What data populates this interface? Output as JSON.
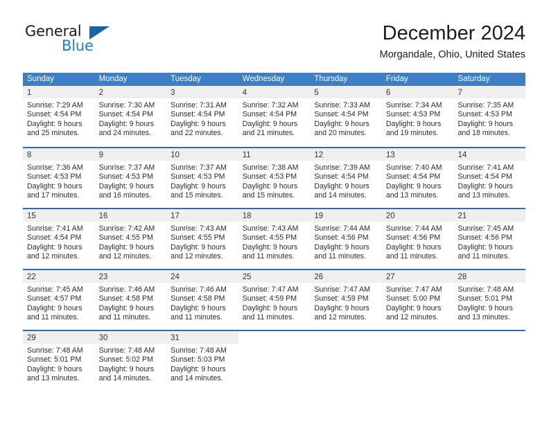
{
  "brand": {
    "name_top": "General",
    "name_bottom": "Blue",
    "accent_color": "#1f7ac4",
    "triangle_color": "#1565a8"
  },
  "header": {
    "month_title": "December 2024",
    "location": "Morgandale, Ohio, United States"
  },
  "calendar": {
    "header_color": "#3b7fc4",
    "separator_color": "#2a6db5",
    "daynum_band_color": "#efefef",
    "weekdays": [
      "Sunday",
      "Monday",
      "Tuesday",
      "Wednesday",
      "Thursday",
      "Friday",
      "Saturday"
    ],
    "weeks": [
      [
        {
          "day": "1",
          "lines": [
            "Sunrise: 7:29 AM",
            "Sunset: 4:54 PM",
            "Daylight: 9 hours",
            "and 25 minutes."
          ]
        },
        {
          "day": "2",
          "lines": [
            "Sunrise: 7:30 AM",
            "Sunset: 4:54 PM",
            "Daylight: 9 hours",
            "and 24 minutes."
          ]
        },
        {
          "day": "3",
          "lines": [
            "Sunrise: 7:31 AM",
            "Sunset: 4:54 PM",
            "Daylight: 9 hours",
            "and 22 minutes."
          ]
        },
        {
          "day": "4",
          "lines": [
            "Sunrise: 7:32 AM",
            "Sunset: 4:54 PM",
            "Daylight: 9 hours",
            "and 21 minutes."
          ]
        },
        {
          "day": "5",
          "lines": [
            "Sunrise: 7:33 AM",
            "Sunset: 4:54 PM",
            "Daylight: 9 hours",
            "and 20 minutes."
          ]
        },
        {
          "day": "6",
          "lines": [
            "Sunrise: 7:34 AM",
            "Sunset: 4:53 PM",
            "Daylight: 9 hours",
            "and 19 minutes."
          ]
        },
        {
          "day": "7",
          "lines": [
            "Sunrise: 7:35 AM",
            "Sunset: 4:53 PM",
            "Daylight: 9 hours",
            "and 18 minutes."
          ]
        }
      ],
      [
        {
          "day": "8",
          "lines": [
            "Sunrise: 7:36 AM",
            "Sunset: 4:53 PM",
            "Daylight: 9 hours",
            "and 17 minutes."
          ]
        },
        {
          "day": "9",
          "lines": [
            "Sunrise: 7:37 AM",
            "Sunset: 4:53 PM",
            "Daylight: 9 hours",
            "and 16 minutes."
          ]
        },
        {
          "day": "10",
          "lines": [
            "Sunrise: 7:37 AM",
            "Sunset: 4:53 PM",
            "Daylight: 9 hours",
            "and 15 minutes."
          ]
        },
        {
          "day": "11",
          "lines": [
            "Sunrise: 7:38 AM",
            "Sunset: 4:53 PM",
            "Daylight: 9 hours",
            "and 15 minutes."
          ]
        },
        {
          "day": "12",
          "lines": [
            "Sunrise: 7:39 AM",
            "Sunset: 4:54 PM",
            "Daylight: 9 hours",
            "and 14 minutes."
          ]
        },
        {
          "day": "13",
          "lines": [
            "Sunrise: 7:40 AM",
            "Sunset: 4:54 PM",
            "Daylight: 9 hours",
            "and 13 minutes."
          ]
        },
        {
          "day": "14",
          "lines": [
            "Sunrise: 7:41 AM",
            "Sunset: 4:54 PM",
            "Daylight: 9 hours",
            "and 13 minutes."
          ]
        }
      ],
      [
        {
          "day": "15",
          "lines": [
            "Sunrise: 7:41 AM",
            "Sunset: 4:54 PM",
            "Daylight: 9 hours",
            "and 12 minutes."
          ]
        },
        {
          "day": "16",
          "lines": [
            "Sunrise: 7:42 AM",
            "Sunset: 4:55 PM",
            "Daylight: 9 hours",
            "and 12 minutes."
          ]
        },
        {
          "day": "17",
          "lines": [
            "Sunrise: 7:43 AM",
            "Sunset: 4:55 PM",
            "Daylight: 9 hours",
            "and 12 minutes."
          ]
        },
        {
          "day": "18",
          "lines": [
            "Sunrise: 7:43 AM",
            "Sunset: 4:55 PM",
            "Daylight: 9 hours",
            "and 11 minutes."
          ]
        },
        {
          "day": "19",
          "lines": [
            "Sunrise: 7:44 AM",
            "Sunset: 4:56 PM",
            "Daylight: 9 hours",
            "and 11 minutes."
          ]
        },
        {
          "day": "20",
          "lines": [
            "Sunrise: 7:44 AM",
            "Sunset: 4:56 PM",
            "Daylight: 9 hours",
            "and 11 minutes."
          ]
        },
        {
          "day": "21",
          "lines": [
            "Sunrise: 7:45 AM",
            "Sunset: 4:56 PM",
            "Daylight: 9 hours",
            "and 11 minutes."
          ]
        }
      ],
      [
        {
          "day": "22",
          "lines": [
            "Sunrise: 7:45 AM",
            "Sunset: 4:57 PM",
            "Daylight: 9 hours",
            "and 11 minutes."
          ]
        },
        {
          "day": "23",
          "lines": [
            "Sunrise: 7:46 AM",
            "Sunset: 4:58 PM",
            "Daylight: 9 hours",
            "and 11 minutes."
          ]
        },
        {
          "day": "24",
          "lines": [
            "Sunrise: 7:46 AM",
            "Sunset: 4:58 PM",
            "Daylight: 9 hours",
            "and 11 minutes."
          ]
        },
        {
          "day": "25",
          "lines": [
            "Sunrise: 7:47 AM",
            "Sunset: 4:59 PM",
            "Daylight: 9 hours",
            "and 11 minutes."
          ]
        },
        {
          "day": "26",
          "lines": [
            "Sunrise: 7:47 AM",
            "Sunset: 4:59 PM",
            "Daylight: 9 hours",
            "and 12 minutes."
          ]
        },
        {
          "day": "27",
          "lines": [
            "Sunrise: 7:47 AM",
            "Sunset: 5:00 PM",
            "Daylight: 9 hours",
            "and 12 minutes."
          ]
        },
        {
          "day": "28",
          "lines": [
            "Sunrise: 7:48 AM",
            "Sunset: 5:01 PM",
            "Daylight: 9 hours",
            "and 13 minutes."
          ]
        }
      ],
      [
        {
          "day": "29",
          "lines": [
            "Sunrise: 7:48 AM",
            "Sunset: 5:01 PM",
            "Daylight: 9 hours",
            "and 13 minutes."
          ]
        },
        {
          "day": "30",
          "lines": [
            "Sunrise: 7:48 AM",
            "Sunset: 5:02 PM",
            "Daylight: 9 hours",
            "and 14 minutes."
          ]
        },
        {
          "day": "31",
          "lines": [
            "Sunrise: 7:48 AM",
            "Sunset: 5:03 PM",
            "Daylight: 9 hours",
            "and 14 minutes."
          ]
        },
        {
          "day": "",
          "lines": []
        },
        {
          "day": "",
          "lines": []
        },
        {
          "day": "",
          "lines": []
        },
        {
          "day": "",
          "lines": []
        }
      ]
    ]
  }
}
